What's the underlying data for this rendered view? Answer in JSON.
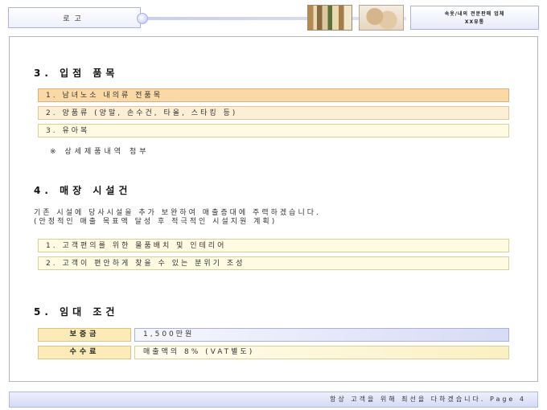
{
  "header": {
    "logo": "로고",
    "right_line1": "속옷/내의 전문판매 업체",
    "right_line2": "XX유통"
  },
  "section3": {
    "title": "3. 입점 품목",
    "items": [
      "1. 남녀노소 내의류 전품목",
      "2. 양품류 (양말, 손수건, 타올, 스타킹 등)",
      "3. 유아복"
    ],
    "note": "※ 상세제품내역 첨부"
  },
  "section4": {
    "title": "4. 매장 시설건",
    "para_line1": "기존 시설에 당사시설을 추가 보완하여 매출증대에 주력하겠습니다.",
    "para_line2": "(안정적인 매출 목표액 달성 후 적극적인 시설지원 계획)",
    "items": [
      "1. 고객편의를 위한 물품배치 및 인테리어",
      "2. 고객이 편안하게 찾을 수 있는 분위기 조성"
    ]
  },
  "section5": {
    "title": "5. 임대 조건",
    "rows": [
      {
        "label": "보증금",
        "value": "1,500만원"
      },
      {
        "label": "수수료",
        "value": "매출액의 8% (VAT별도)"
      }
    ]
  },
  "footer": {
    "text": "항상 고객을 위해 최선을 다하겠습니다. Page 4"
  }
}
